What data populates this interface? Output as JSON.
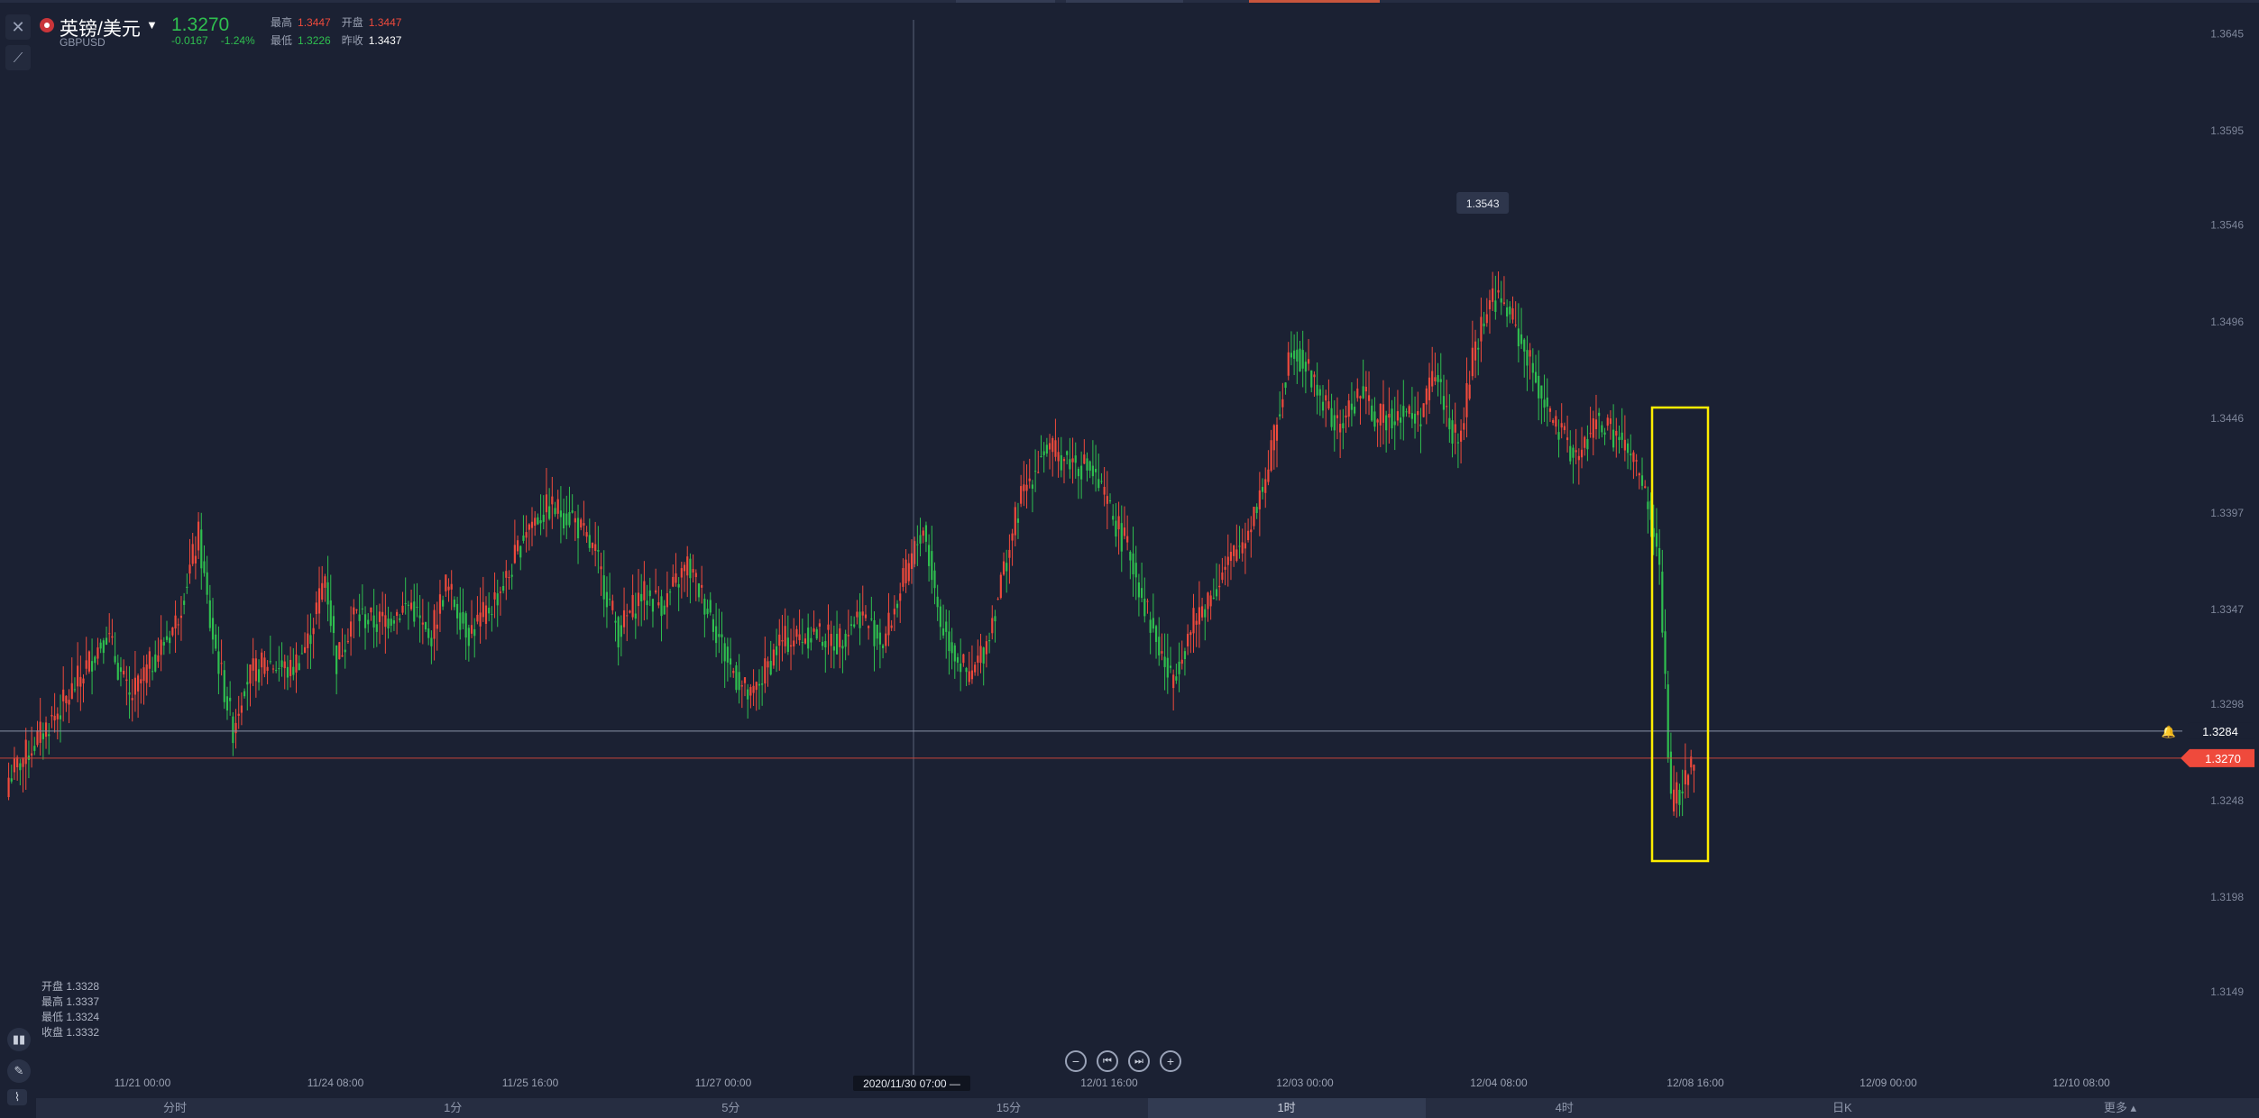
{
  "symbol": {
    "name": "英镑/美元",
    "code": "GBPUSD",
    "last": "1.3270",
    "change": "-0.0167",
    "change_pct": "-1.24%",
    "stats": {
      "high_label": "最高",
      "high": "1.3447",
      "open_label": "开盘",
      "open": "1.3447",
      "low_label": "最低",
      "low": "1.3226",
      "prev_label": "昨收",
      "prev": "1.3437"
    }
  },
  "ohlc_readout": [
    "开盘 1.3328",
    "最高 1.3337",
    "最低 1.3324",
    "收盘 1.3332"
  ],
  "crosshair_label": "2020/11/30 07:00 —",
  "tooltip_high": "1.3543",
  "price_lines": {
    "reference": "1.3284",
    "current": "1.3270"
  },
  "timeframes": [
    "分时",
    "1分",
    "5分",
    "15分",
    "1时",
    "4时",
    "日K",
    "更多 ▴"
  ],
  "active_timeframe": "1时",
  "colors": {
    "background": "#1b2133",
    "up": "#2fbf4f",
    "down": "#ef4a3c",
    "highlight": "#ffee00"
  },
  "chart_data": {
    "type": "candlestick",
    "interval": "1时",
    "ylim": [
      1.3135,
      1.365
    ],
    "y_ticks": [
      "1.3645",
      "1.3595",
      "1.3546",
      "1.3496",
      "1.3446",
      "1.3397",
      "1.3347",
      "1.3298",
      "1.3248",
      "1.3198",
      "1.3149"
    ],
    "x_ticks": [
      "11/21 00:00",
      "11/24 08:00",
      "11/25 16:00",
      "11/27 00:00",
      "12/01 16:00",
      "12/03 00:00",
      "12/04 08:00",
      "12/08 16:00",
      "12/09 00:00",
      "12/10 08:00"
    ],
    "annotated_high": 1.3543,
    "highlighted_range": [
      "12/08",
      "12/08"
    ],
    "close_path": [
      [
        0,
        1.326
      ],
      [
        20,
        1.33
      ],
      [
        34,
        1.3335
      ],
      [
        42,
        1.33
      ],
      [
        58,
        1.334
      ],
      [
        66,
        1.3385
      ],
      [
        70,
        1.334
      ],
      [
        78,
        1.3285
      ],
      [
        82,
        1.331
      ],
      [
        90,
        1.332
      ],
      [
        98,
        1.3315
      ],
      [
        104,
        1.333
      ],
      [
        110,
        1.3365
      ],
      [
        114,
        1.332
      ],
      [
        120,
        1.3345
      ],
      [
        128,
        1.334
      ],
      [
        140,
        1.335
      ],
      [
        146,
        1.333
      ],
      [
        152,
        1.336
      ],
      [
        160,
        1.3335
      ],
      [
        166,
        1.3345
      ],
      [
        174,
        1.3365
      ],
      [
        180,
        1.339
      ],
      [
        188,
        1.34
      ],
      [
        196,
        1.3395
      ],
      [
        204,
        1.3375
      ],
      [
        212,
        1.3335
      ],
      [
        220,
        1.3355
      ],
      [
        228,
        1.335
      ],
      [
        236,
        1.337
      ],
      [
        244,
        1.3345
      ],
      [
        250,
        1.332
      ],
      [
        258,
        1.33
      ],
      [
        268,
        1.333
      ],
      [
        280,
        1.3335
      ],
      [
        288,
        1.333
      ],
      [
        296,
        1.3345
      ],
      [
        304,
        1.333
      ],
      [
        312,
        1.3365
      ],
      [
        318,
        1.339
      ],
      [
        324,
        1.334
      ],
      [
        334,
        1.331
      ],
      [
        340,
        1.333
      ],
      [
        352,
        1.3405
      ],
      [
        360,
        1.343
      ],
      [
        368,
        1.3425
      ],
      [
        376,
        1.342
      ],
      [
        384,
        1.3395
      ],
      [
        390,
        1.3375
      ],
      [
        398,
        1.3335
      ],
      [
        404,
        1.331
      ],
      [
        412,
        1.334
      ],
      [
        420,
        1.336
      ],
      [
        430,
        1.3385
      ],
      [
        438,
        1.342
      ],
      [
        446,
        1.3485
      ],
      [
        452,
        1.347
      ],
      [
        462,
        1.344
      ],
      [
        470,
        1.346
      ],
      [
        476,
        1.3445
      ],
      [
        484,
        1.345
      ],
      [
        490,
        1.3445
      ],
      [
        496,
        1.347
      ],
      [
        504,
        1.343
      ],
      [
        510,
        1.3485
      ],
      [
        516,
        1.351
      ],
      [
        522,
        1.35
      ],
      [
        530,
        1.347
      ],
      [
        538,
        1.344
      ],
      [
        546,
        1.3425
      ],
      [
        552,
        1.3445
      ],
      [
        560,
        1.3435
      ],
      [
        566,
        1.342
      ],
      [
        570,
        1.34
      ],
      [
        574,
        1.337
      ],
      [
        578,
        1.3245
      ],
      [
        582,
        1.3255
      ],
      [
        586,
        1.327
      ]
    ],
    "note_close_path": "pairs are [candle_index, close_price]; intermediate candles interpolated"
  }
}
